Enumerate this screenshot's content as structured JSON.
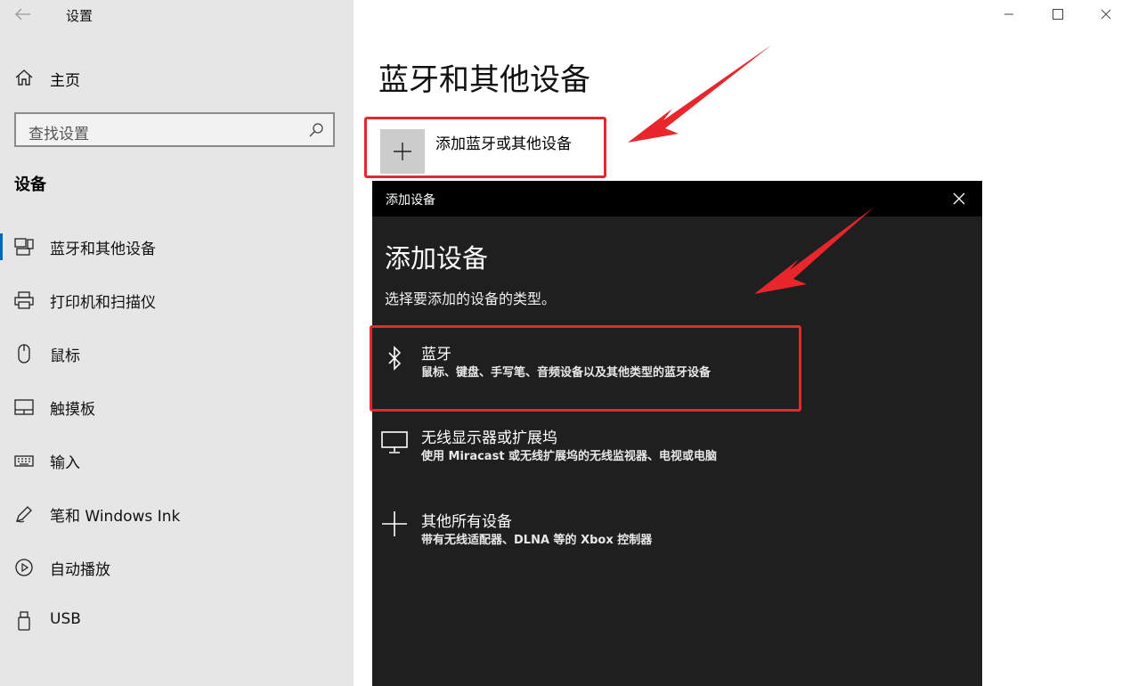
{
  "window": {
    "title": "设置",
    "controls": [
      "minimize-icon",
      "maximize-icon",
      "close-icon"
    ]
  },
  "sidebar": {
    "home_label": "主页",
    "search_placeholder": "查找设置",
    "section_title": "设备",
    "items": [
      {
        "label": "蓝牙和其他设备",
        "icon": "bluetooth-devices-icon",
        "active": true
      },
      {
        "label": "打印机和扫描仪",
        "icon": "printer-icon",
        "active": false
      },
      {
        "label": "鼠标",
        "icon": "mouse-icon",
        "active": false
      },
      {
        "label": "触摸板",
        "icon": "touchpad-icon",
        "active": false
      },
      {
        "label": "输入",
        "icon": "keyboard-icon",
        "active": false
      },
      {
        "label": "笔和 Windows Ink",
        "icon": "pen-icon",
        "active": false
      },
      {
        "label": "自动播放",
        "icon": "autoplay-icon",
        "active": false
      },
      {
        "label": "USB",
        "icon": "usb-icon",
        "active": false
      }
    ]
  },
  "main": {
    "title": "蓝牙和其他设备",
    "add_device_label": "添加蓝牙或其他设备"
  },
  "dialog": {
    "bar_title": "添加设备",
    "heading": "添加设备",
    "subtitle": "选择要添加的设备的类型。",
    "options": [
      {
        "name": "蓝牙",
        "desc": "鼠标、键盘、手写笔、音频设备以及其他类型的蓝牙设备",
        "icon": "bluetooth-icon"
      },
      {
        "name": "无线显示器或扩展坞",
        "desc": "使用 Miracast 或无线扩展坞的无线监视器、电视或电脑",
        "icon": "monitor-icon"
      },
      {
        "name": "其他所有设备",
        "desc": "带有无线适配器、DLNA 等的 Xbox 控制器",
        "icon": "plus-icon"
      }
    ]
  },
  "colors": {
    "sidebar_bg": "#e6e6e6",
    "dialog_bg": "#1f1f1f",
    "annotation_red": "#e8262c",
    "accent": "#0067c0"
  }
}
